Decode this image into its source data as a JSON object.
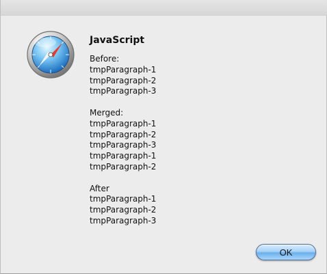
{
  "dialog": {
    "title": "JavaScript",
    "message_lines": [
      "Before:",
      "tmpParagraph-1",
      "tmpParagraph-2",
      "tmpParagraph-3",
      "",
      "Merged:",
      "tmpParagraph-1",
      "tmpParagraph-2",
      "tmpParagraph-3",
      "tmpParagraph-1",
      "tmpParagraph-2",
      "",
      "After",
      "tmpParagraph-1",
      "tmpParagraph-2",
      "tmpParagraph-3"
    ],
    "ok_label": "OK",
    "icon": "safari-compass-icon"
  },
  "colors": {
    "window_bg": "#ececec",
    "button_blue": "#6cb0ec",
    "text": "#111111"
  }
}
